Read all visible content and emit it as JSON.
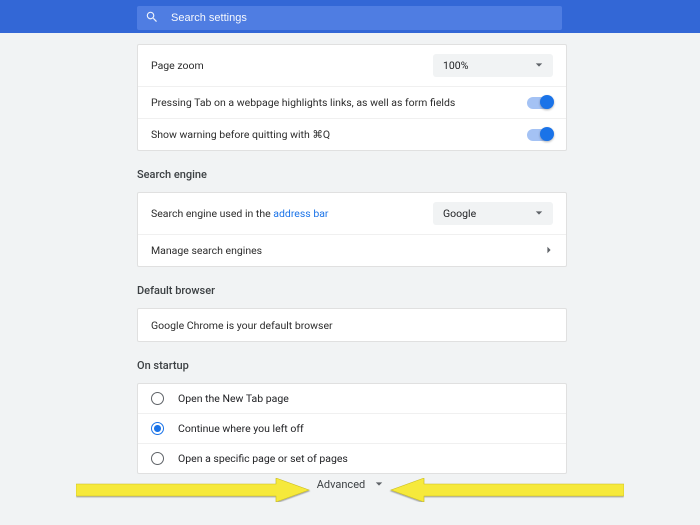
{
  "search": {
    "placeholder": "Search settings"
  },
  "appearance": {
    "page_zoom_label": "Page zoom",
    "page_zoom_value": "100%",
    "tab_highlight_label": "Pressing Tab on a webpage highlights links, as well as form fields",
    "quit_warning_label": "Show warning before quitting with ⌘Q"
  },
  "search_engine": {
    "section_title": "Search engine",
    "used_label_pre": "Search engine used in the ",
    "used_label_link": "address bar",
    "selected_value": "Google",
    "manage_label": "Manage search engines"
  },
  "default_browser": {
    "section_title": "Default browser",
    "message": "Google Chrome is your default browser"
  },
  "startup": {
    "section_title": "On startup",
    "options": [
      {
        "label": "Open the New Tab page"
      },
      {
        "label": "Continue where you left off"
      },
      {
        "label": "Open a specific page or set of pages"
      }
    ],
    "selected_index": 1
  },
  "advanced_label": "Advanced"
}
